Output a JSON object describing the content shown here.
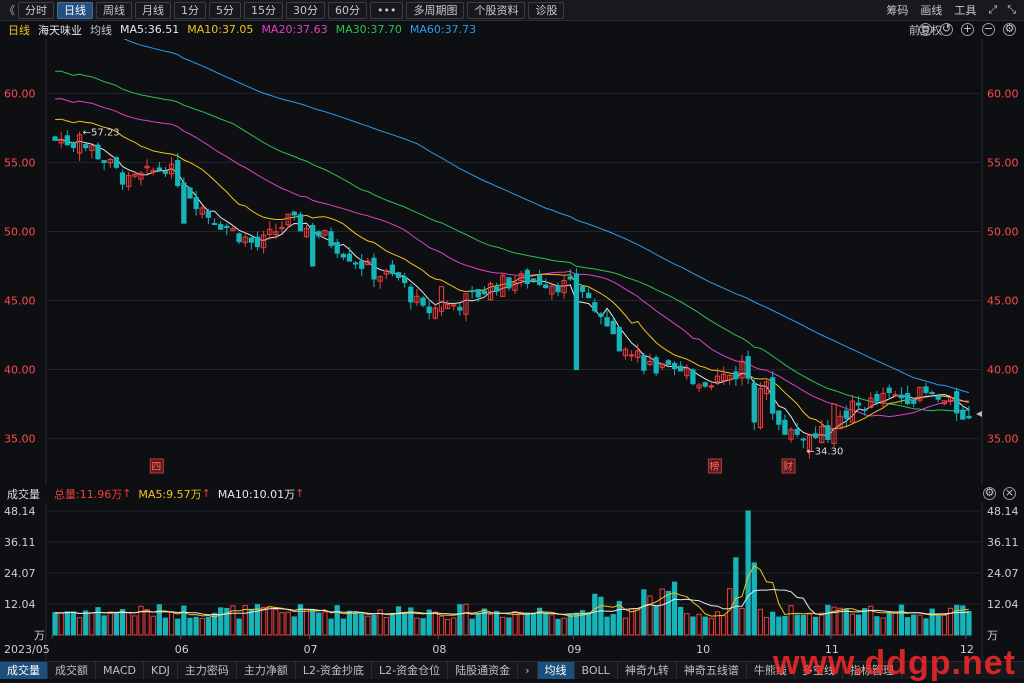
{
  "toolbar": {
    "back_glyph": "《",
    "buttons": [
      "分时",
      "日线",
      "周线",
      "月线",
      "1分",
      "5分",
      "15分",
      "30分",
      "60分",
      "•••",
      "多周期图",
      "个股资料",
      "诊股"
    ],
    "active": "日线",
    "right": [
      "筹码",
      "画线",
      "工具"
    ]
  },
  "ma_line": {
    "period": "日线",
    "name": "海天味业",
    "type": "均线",
    "ma5": {
      "label": "MA5:36.51",
      "color": "#e8e8e8"
    },
    "ma10": {
      "label": "MA10:37.05",
      "color": "#f2c318"
    },
    "ma20": {
      "label": "MA20:37.63",
      "color": "#e43fc5"
    },
    "ma30": {
      "label": "MA30:37.70",
      "color": "#2ec04e"
    },
    "ma60": {
      "label": "MA60:37.73",
      "color": "#2b9bf0"
    },
    "right_label": "前复权"
  },
  "price_axis": {
    "ticks": [
      "60.00",
      "55.00",
      "50.00",
      "45.00",
      "40.00",
      "35.00"
    ],
    "min": 32.8,
    "max": 63.5
  },
  "price_annotations": {
    "high": "57.23",
    "low": "34.30"
  },
  "event_markers": [
    "四",
    "榜",
    "财"
  ],
  "volume_line": {
    "title": "成交量",
    "total": "总量:11.96万",
    "ma5": "MA5:9.57万",
    "ma10": "MA10:10.01万"
  },
  "volume_axis": {
    "ticks": [
      "48.14",
      "36.11",
      "24.07",
      "12.04"
    ],
    "unit": "万",
    "max": 48.14
  },
  "date_axis": [
    "2023/05",
    "06",
    "07",
    "08",
    "09",
    "10",
    "11",
    "12"
  ],
  "bottom_tabs": [
    "成交量",
    "成交额",
    "MACD",
    "KDJ",
    "主力密码",
    "主力净额",
    "L2-资金抄底",
    "L2-资金仓位",
    "陆股通资金",
    "均线",
    "BOLL",
    "神奇九转",
    "神奇五线谱",
    "牛熊线",
    "多空线",
    "指标管理"
  ],
  "active_tab": "成交量",
  "active_tab_right": "均线",
  "watermark": "www.ddgp.net",
  "colors": {
    "up": "#f23c3c",
    "down": "#16b3b8",
    "axis_text": "#ff4a4a",
    "background": "#0e0f13"
  },
  "chart_data": {
    "type": "candlestick",
    "anchors": {
      "dates": [
        "2023/05",
        "06",
        "07",
        "08",
        "09",
        "10",
        "11",
        "12"
      ],
      "closes": [
        56.6,
        50.6,
        47.5,
        46.0,
        40.0,
        38.8,
        37.5,
        36.5
      ]
    },
    "price_range": [
      32.8,
      63.5
    ],
    "volume_range": [
      0,
      48.14
    ],
    "ma_lines": [
      "MA5",
      "MA10",
      "MA20",
      "MA30",
      "MA60"
    ]
  }
}
